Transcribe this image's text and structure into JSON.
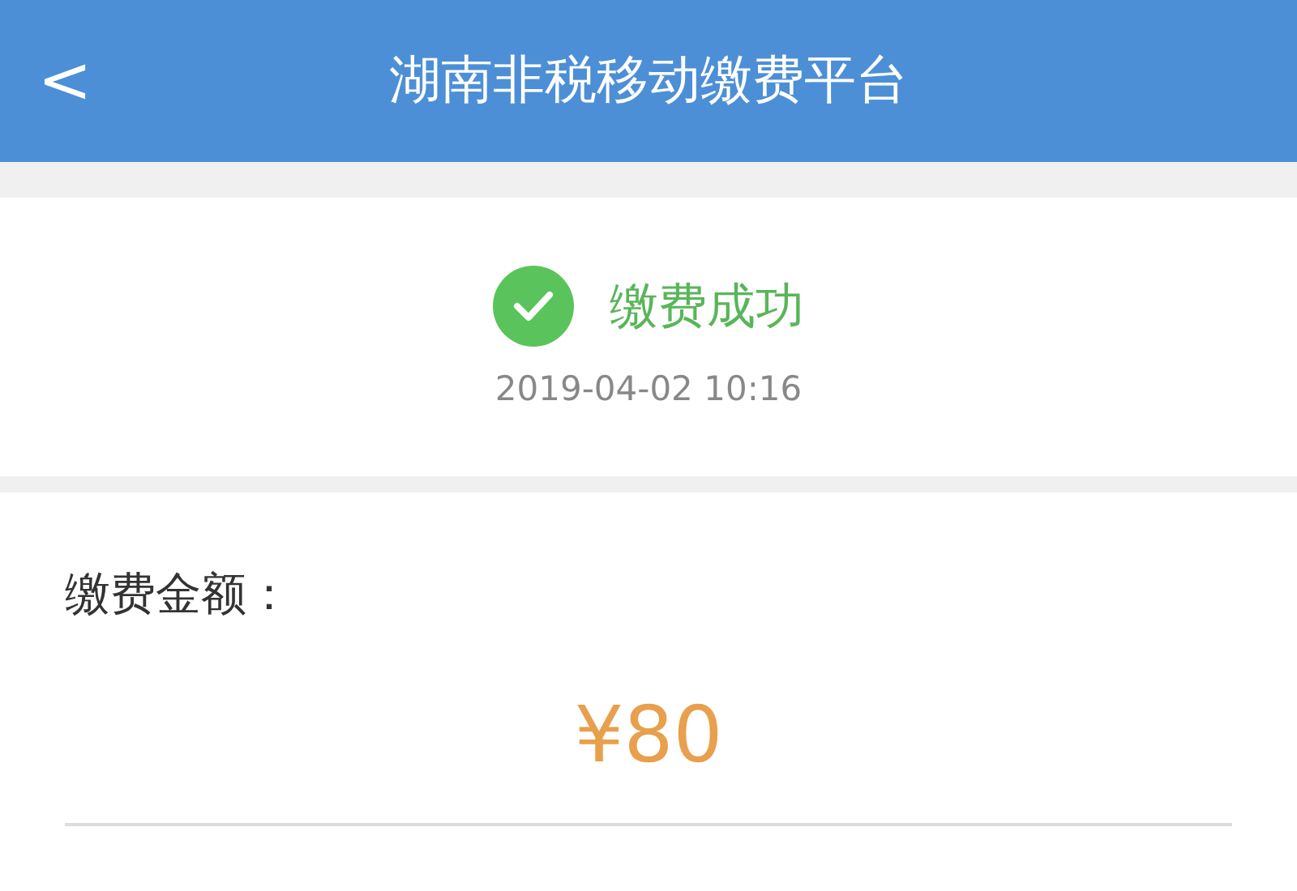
{
  "nav_bar": {
    "title": "湖南非税移动缴费平台",
    "back": "<"
  },
  "result": {
    "status": "缴费成功",
    "success": true,
    "time": "2019-04-02 10:16"
  },
  "amount": {
    "label": "缴费金额：",
    "value": "¥80"
  }
}
